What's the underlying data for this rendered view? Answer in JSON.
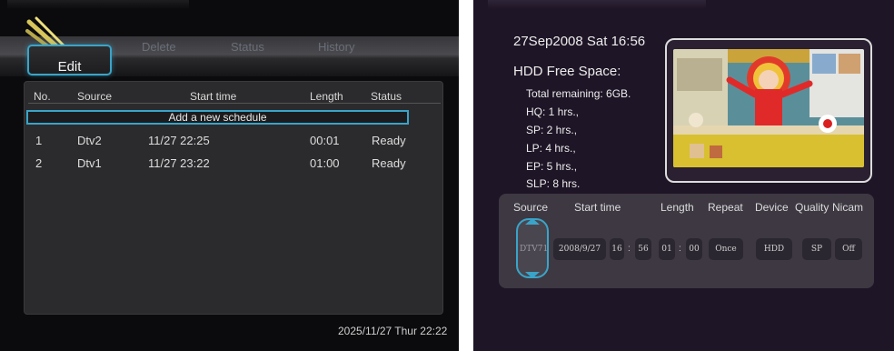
{
  "left": {
    "tabs": {
      "edit": "Edit",
      "delete": "Delete",
      "status": "Status",
      "history": "History"
    },
    "table": {
      "headers": [
        "No.",
        "Source",
        "Start time",
        "Length",
        "Status"
      ],
      "add_row": "Add a new schedule",
      "rows": [
        {
          "no": "1",
          "source": "Dtv2",
          "start": "11/27 22:25",
          "length": "00:01",
          "status": "Ready"
        },
        {
          "no": "2",
          "source": "Dtv1",
          "start": "11/27 23:22",
          "length": "01:00",
          "status": "Ready"
        }
      ]
    },
    "datetime": "2025/11/27 Thur 22:22",
    "colors": {
      "accent": "#3aa4c8",
      "background": "#0b0b0d"
    }
  },
  "right": {
    "datetime": "27Sep2008 Sat 16:56",
    "free_space_title": "HDD Free Space:",
    "free_space_items": [
      "Total remaining: 6GB.",
      "HQ: 1 hrs.,",
      "SP: 2 hrs.,",
      "LP: 4 hrs.,",
      "EP: 5 hrs.,",
      "SLP: 8 hrs."
    ],
    "form": {
      "labels": {
        "source": "Source",
        "start_time": "Start time",
        "length": "Length",
        "repeat": "Repeat",
        "device": "Device",
        "quality": "Quality",
        "nicam": "Nicam"
      },
      "values": {
        "source": "DTV71",
        "date": "2008/9/27",
        "hour": "16",
        "minute": "56",
        "length_h": "01",
        "length_m": "00",
        "repeat": "Once",
        "device": "HDD",
        "quality": "SP",
        "nicam": "Off"
      },
      "separator": ":"
    },
    "colors": {
      "accent": "#3aa4c8",
      "background": "#1e1526"
    }
  }
}
